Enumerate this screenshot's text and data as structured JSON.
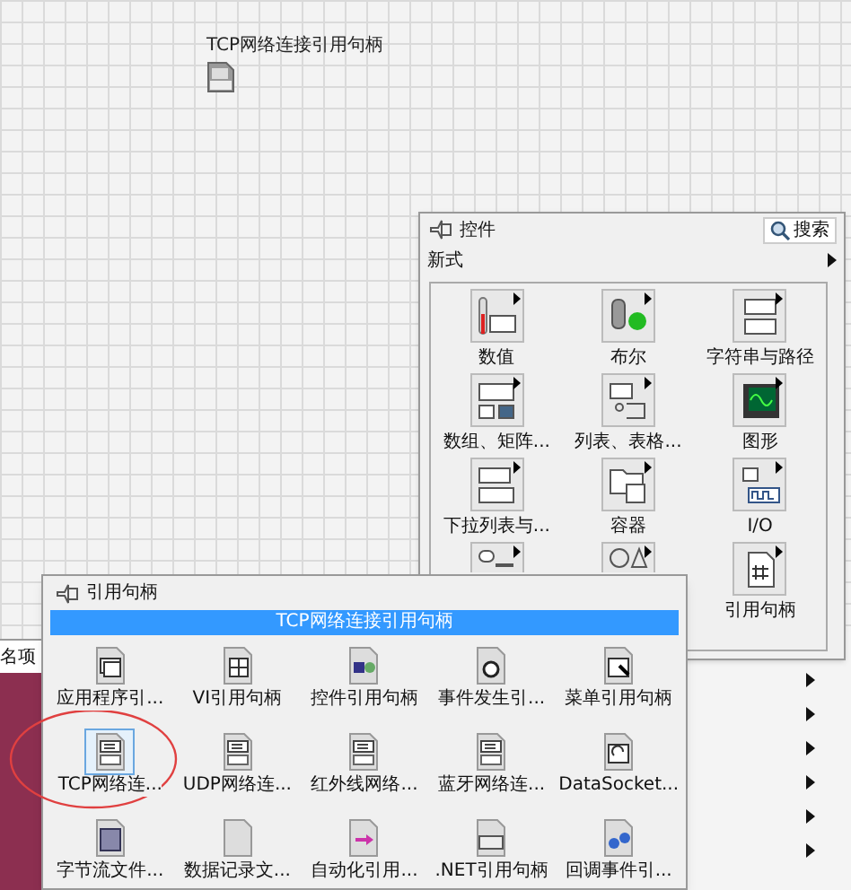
{
  "front_panel": {
    "label": "TCP网络连接引用句柄"
  },
  "background_window": {
    "partial_text": "名项"
  },
  "controls_palette": {
    "title": "控件",
    "search_button": "搜索",
    "category": "新式",
    "items": [
      {
        "kind": "category",
        "label": "数值"
      },
      {
        "kind": "category",
        "label": "布尔"
      },
      {
        "kind": "category",
        "label": "字符串与路径"
      },
      {
        "kind": "category",
        "label": "数组、矩阵..."
      },
      {
        "kind": "category",
        "label": "列表、表格..."
      },
      {
        "kind": "category",
        "label": "图形"
      },
      {
        "kind": "category",
        "label": "下拉列表与..."
      },
      {
        "kind": "category",
        "label": "容器"
      },
      {
        "kind": "category",
        "label": "I/O"
      },
      {
        "kind": "partial"
      },
      {
        "kind": "partial"
      },
      {
        "kind": "category",
        "label": "引用句柄"
      }
    ]
  },
  "refnum_palette": {
    "title": "引用句柄",
    "hover_title": "TCP网络连接引用句柄",
    "items": [
      {
        "label": "应用程序引...",
        "selected": false
      },
      {
        "label": "VI引用句柄",
        "selected": false
      },
      {
        "label": "控件引用句柄",
        "selected": false
      },
      {
        "label": "事件发生引...",
        "selected": false
      },
      {
        "label": "菜单引用句柄",
        "selected": false
      },
      {
        "label": "TCP网络连...",
        "selected": true
      },
      {
        "label": "UDP网络连...",
        "selected": false
      },
      {
        "label": "红外线网络...",
        "selected": false
      },
      {
        "label": "蓝牙网络连...",
        "selected": false
      },
      {
        "label": "DataSocket...",
        "selected": false
      },
      {
        "label": "字节流文件...",
        "selected": false
      },
      {
        "label": "数据记录文...",
        "selected": false
      },
      {
        "label": "自动化引用...",
        "selected": false
      },
      {
        "label": ".NET引用句柄",
        "selected": false
      },
      {
        "label": "回调事件引...",
        "selected": false
      }
    ]
  }
}
